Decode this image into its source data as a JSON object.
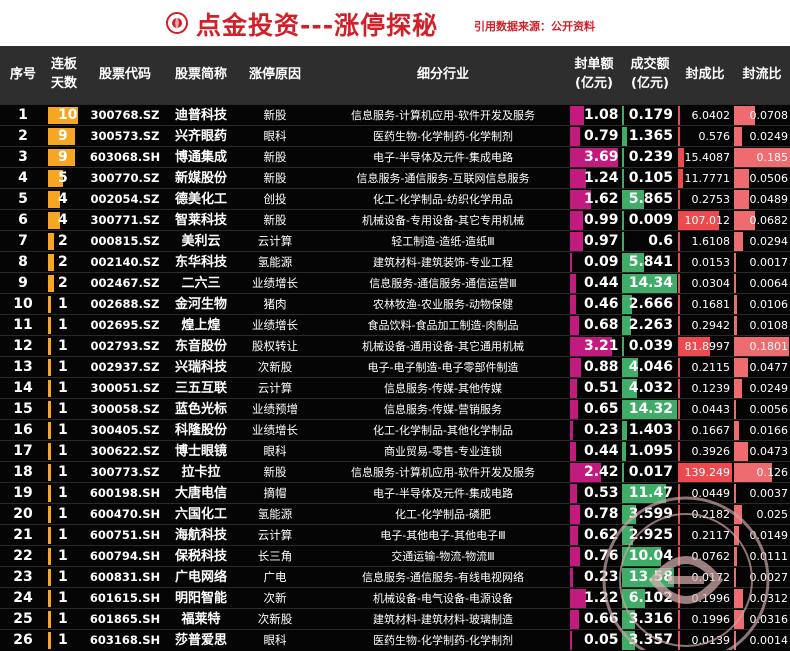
{
  "header": {
    "title": "点金投资---涨停探秘",
    "source": "引用数据来源：公开资料"
  },
  "columns": {
    "idx": "序号",
    "days_1": "连板",
    "days_2": "天数",
    "code": "股票代码",
    "name": "股票简称",
    "reason": "涨停原因",
    "industry": "细分行业",
    "fd_1": "封单额",
    "fd_2": "(亿元)",
    "cj_1": "成交额",
    "cj_2": "(亿元)",
    "fcb": "封成比",
    "fl": "封流比"
  },
  "colors": {
    "days_bar": "#f5a623",
    "fd_bar": "#c21a7e",
    "cj_bar": "#3fad68",
    "fcb_bar": "#ec4a4f",
    "fl_bar": "#ee6b70",
    "title": "#d1202a"
  },
  "rows": [
    {
      "idx": "1",
      "days": "10",
      "code": "300768.SZ",
      "name": "迪普科技",
      "reason": "新股",
      "industry": "信息服务-计算机应用-软件开发及服务",
      "fd": "1.08",
      "cj": "0.179",
      "fcb": "6.0402",
      "fl": "0.0708"
    },
    {
      "idx": "2",
      "days": "9",
      "code": "300573.SZ",
      "name": "兴齐眼药",
      "reason": "眼科",
      "industry": "医药生物-化学制药-化学制剂",
      "fd": "0.79",
      "cj": "1.365",
      "fcb": "0.576",
      "fl": "0.0249"
    },
    {
      "idx": "3",
      "days": "9",
      "code": "603068.SH",
      "name": "博通集成",
      "reason": "新股",
      "industry": "电子-半导体及元件-集成电路",
      "fd": "3.69",
      "cj": "0.239",
      "fcb": "15.4087",
      "fl": "0.185"
    },
    {
      "idx": "4",
      "days": "5",
      "code": "300770.SZ",
      "name": "新媒股份",
      "reason": "新股",
      "industry": "信息服务-通信服务-互联网信息服务",
      "fd": "1.24",
      "cj": "0.105",
      "fcb": "11.7771",
      "fl": "0.0506"
    },
    {
      "idx": "5",
      "days": "4",
      "code": "002054.SZ",
      "name": "德美化工",
      "reason": "创投",
      "industry": "化工-化学制品-纺织化学用品",
      "fd": "1.62",
      "cj": "5.865",
      "fcb": "0.2753",
      "fl": "0.0489"
    },
    {
      "idx": "6",
      "days": "4",
      "code": "300771.SZ",
      "name": "智莱科技",
      "reason": "新股",
      "industry": "机械设备-专用设备-其它专用机械",
      "fd": "0.99",
      "cj": "0.009",
      "fcb": "107.012",
      "fl": "0.0682"
    },
    {
      "idx": "7",
      "days": "2",
      "code": "000815.SZ",
      "name": "美利云",
      "reason": "云计算",
      "industry": "轻工制造-造纸-造纸Ⅲ",
      "fd": "0.97",
      "cj": "0.6",
      "fcb": "1.6108",
      "fl": "0.0294"
    },
    {
      "idx": "8",
      "days": "2",
      "code": "002140.SZ",
      "name": "东华科技",
      "reason": "氢能源",
      "industry": "建筑材料-建筑装饰-专业工程",
      "fd": "0.09",
      "cj": "5.841",
      "fcb": "0.0153",
      "fl": "0.0017"
    },
    {
      "idx": "9",
      "days": "2",
      "code": "002467.SZ",
      "name": "二六三",
      "reason": "业绩增长",
      "industry": "信息服务-通信服务-通信运营Ⅲ",
      "fd": "0.44",
      "cj": "14.34",
      "fcb": "0.0304",
      "fl": "0.0064"
    },
    {
      "idx": "10",
      "days": "1",
      "code": "002688.SZ",
      "name": "金河生物",
      "reason": "猪肉",
      "industry": "农林牧渔-农业服务-动物保健",
      "fd": "0.46",
      "cj": "2.666",
      "fcb": "0.1681",
      "fl": "0.0106"
    },
    {
      "idx": "11",
      "days": "1",
      "code": "002695.SZ",
      "name": "煌上煌",
      "reason": "业绩增长",
      "industry": "食品饮料-食品加工制造-肉制品",
      "fd": "0.68",
      "cj": "2.263",
      "fcb": "0.2942",
      "fl": "0.0108"
    },
    {
      "idx": "12",
      "days": "1",
      "code": "002793.SZ",
      "name": "东音股份",
      "reason": "股权转让",
      "industry": "机械设备-通用设备-其它通用机械",
      "fd": "3.21",
      "cj": "0.039",
      "fcb": "81.8997",
      "fl": "0.1801"
    },
    {
      "idx": "13",
      "days": "1",
      "code": "002937.SZ",
      "name": "兴瑞科技",
      "reason": "次新股",
      "industry": "电子-电子制造-电子零部件制造",
      "fd": "0.88",
      "cj": "4.046",
      "fcb": "0.2115",
      "fl": "0.0477"
    },
    {
      "idx": "14",
      "days": "1",
      "code": "300051.SZ",
      "name": "三五互联",
      "reason": "云计算",
      "industry": "信息服务-传媒-其他传媒",
      "fd": "0.51",
      "cj": "4.032",
      "fcb": "0.1239",
      "fl": "0.0249"
    },
    {
      "idx": "15",
      "days": "1",
      "code": "300058.SZ",
      "name": "蓝色光标",
      "reason": "业绩预增",
      "industry": "信息服务-传媒-营销服务",
      "fd": "0.65",
      "cj": "14.32",
      "fcb": "0.0443",
      "fl": "0.0056"
    },
    {
      "idx": "16",
      "days": "1",
      "code": "300405.SZ",
      "name": "科隆股份",
      "reason": "业绩增长",
      "industry": "化工-化学制品-其他化学制品",
      "fd": "0.23",
      "cj": "1.403",
      "fcb": "0.1667",
      "fl": "0.0166"
    },
    {
      "idx": "17",
      "days": "1",
      "code": "300622.SZ",
      "name": "博士眼镜",
      "reason": "眼科",
      "industry": "商业贸易-零售-专业连锁",
      "fd": "0.44",
      "cj": "1.095",
      "fcb": "0.3926",
      "fl": "0.0473"
    },
    {
      "idx": "18",
      "days": "1",
      "code": "300773.SZ",
      "name": "拉卡拉",
      "reason": "新股",
      "industry": "信息服务-计算机应用-软件开发及服务",
      "fd": "2.42",
      "cj": "0.017",
      "fcb": "139.249",
      "fl": "0.126"
    },
    {
      "idx": "19",
      "days": "1",
      "code": "600198.SH",
      "name": "大唐电信",
      "reason": "摘帽",
      "industry": "电子-半导体及元件-集成电路",
      "fd": "0.53",
      "cj": "11.47",
      "fcb": "0.0449",
      "fl": "0.0037"
    },
    {
      "idx": "20",
      "days": "1",
      "code": "600470.SH",
      "name": "六国化工",
      "reason": "氢能源",
      "industry": "化工-化学制品-磷肥",
      "fd": "0.78",
      "cj": "3.599",
      "fcb": "0.2182",
      "fl": "0.025"
    },
    {
      "idx": "21",
      "days": "1",
      "code": "600751.SH",
      "name": "海航科技",
      "reason": "云计算",
      "industry": "电子-其他电子-其他电子Ⅲ",
      "fd": "0.62",
      "cj": "2.925",
      "fcb": "0.2117",
      "fl": "0.0149"
    },
    {
      "idx": "22",
      "days": "1",
      "code": "600794.SH",
      "name": "保税科技",
      "reason": "长三角",
      "industry": "交通运输-物流-物流Ⅲ",
      "fd": "0.76",
      "cj": "10.04",
      "fcb": "0.0762",
      "fl": "0.0111"
    },
    {
      "idx": "23",
      "days": "1",
      "code": "600831.SH",
      "name": "广电网络",
      "reason": "广电",
      "industry": "信息服务-通信服务-有线电视网络",
      "fd": "0.23",
      "cj": "13.58",
      "fcb": "0.0172",
      "fl": "0.0027"
    },
    {
      "idx": "24",
      "days": "1",
      "code": "601615.SH",
      "name": "明阳智能",
      "reason": "次新",
      "industry": "机械设备-电气设备-电源设备",
      "fd": "1.22",
      "cj": "6.102",
      "fcb": "0.1996",
      "fl": "0.0312"
    },
    {
      "idx": "25",
      "days": "1",
      "code": "601865.SH",
      "name": "福莱特",
      "reason": "次新股",
      "industry": "建筑材料-建筑材料-玻璃制造",
      "fd": "0.66",
      "cj": "3.316",
      "fcb": "0.1996",
      "fl": "0.0316"
    },
    {
      "idx": "26",
      "days": "1",
      "code": "603168.SH",
      "name": "莎普爱思",
      "reason": "眼科",
      "industry": "医药生物-化学制药-化学制剂",
      "fd": "0.05",
      "cj": "3.357",
      "fcb": "0.0139",
      "fl": "0.0014"
    }
  ]
}
